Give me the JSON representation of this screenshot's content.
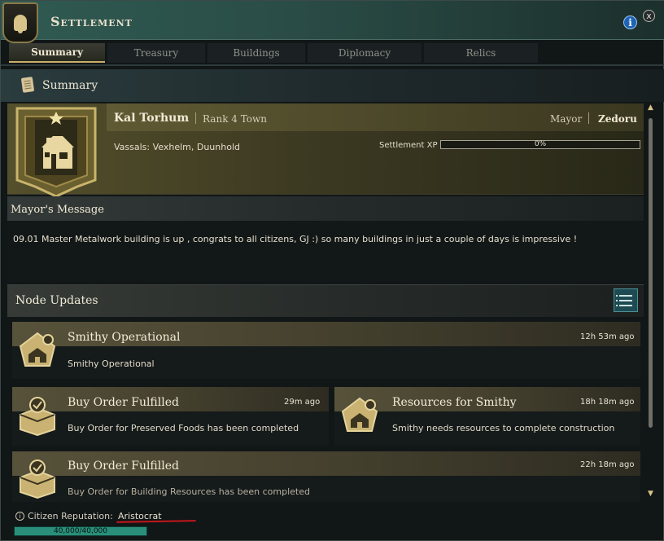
{
  "window": {
    "title": "Settlement",
    "info_icon": "i",
    "close_icon": "x"
  },
  "tabs": [
    {
      "label": "Summary",
      "active": true
    },
    {
      "label": "Treasury",
      "active": false
    },
    {
      "label": "Buildings",
      "active": false
    },
    {
      "label": "Diplomacy",
      "active": false
    },
    {
      "label": "Relics",
      "active": false
    }
  ],
  "section": {
    "title": "Summary"
  },
  "town": {
    "name": "Kal Torhum",
    "rank": "Rank 4 Town",
    "mayor_label": "Mayor",
    "mayor_name": "Zedoru",
    "vassals": "Vassals: Vexhelm, Duunhold",
    "xp_label": "Settlement XP",
    "xp_text": "0%",
    "xp_fraction": 0
  },
  "mayor_message": {
    "title": "Mayor's Message",
    "text": "09.01 Master Metalwork building is up , congrats to all citizens, GJ :) so many buildings in just a couple of days is impressive !"
  },
  "node_updates": {
    "title": "Node Updates",
    "items": [
      {
        "title": "Smithy Operational",
        "time": "12h 53m ago",
        "description": "Smithy Operational",
        "icon": "building-gear-icon"
      },
      {
        "title": "Buy Order Fulfilled",
        "time": "29m ago",
        "description": "Buy Order for Preserved Foods has been completed",
        "icon": "crate-check-icon"
      },
      {
        "title": "Resources for Smithy",
        "time": "18h 18m ago",
        "description": "Smithy needs resources to complete construction",
        "icon": "building-gear-icon"
      },
      {
        "title": "Buy Order Fulfilled",
        "time": "22h 18m ago",
        "description": "Buy Order for Building Resources has been completed",
        "icon": "crate-check-icon"
      }
    ]
  },
  "footer": {
    "label": "Citizen Reputation:",
    "value": "Aristocrat",
    "bar_text": "40,000/40,000",
    "bar_fraction": 1,
    "info_icon": "i"
  },
  "colors": {
    "accent_gold": "#c9b06a",
    "teal": "#2f5a52",
    "rep_bar": "#2a8f7a",
    "underline_red": "#c4161b"
  }
}
